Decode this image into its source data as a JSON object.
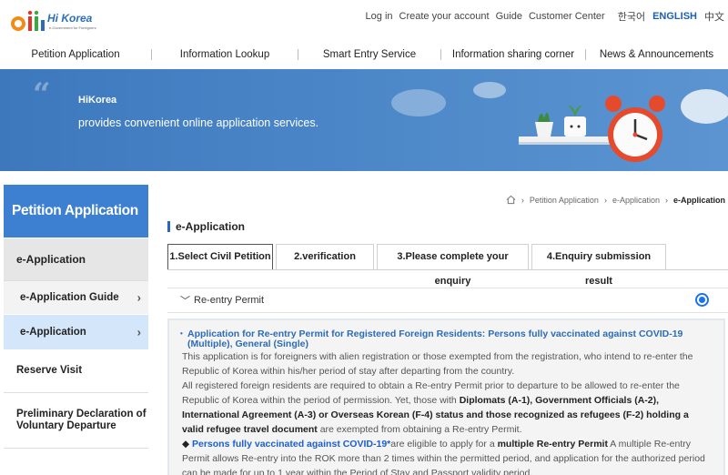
{
  "header": {
    "logo_text": "Hi Korea",
    "logo_sub": "e-Government for Foreigners",
    "util_links": [
      "Log in",
      "Create your account",
      "Guide",
      "Customer Center"
    ],
    "languages": [
      "한국어",
      "ENGLISH",
      "中文"
    ],
    "active_language": "ENGLISH"
  },
  "nav": [
    "Petition Application",
    "Information Lookup",
    "Smart Entry Service",
    "Information sharing corner",
    "News & Announcements"
  ],
  "banner": {
    "title": "HiKorea",
    "subtitle": "provides convenient online application services.",
    "quote_mark": "“"
  },
  "sidebar": {
    "heading": "Petition Application",
    "items": [
      {
        "label": "e-Application"
      },
      {
        "label": "e-Application Guide"
      },
      {
        "label": "e-Application"
      },
      {
        "label": "Reserve Visit"
      },
      {
        "label": "Preliminary Declaration of Voluntary Departure"
      }
    ]
  },
  "breadcrumb": [
    "Petition Application",
    "e-Application",
    "e-Application"
  ],
  "page_title": "e-Application",
  "tabs": [
    "1.Select Civil Petition",
    "2.verification",
    "3.Please complete your enquiry",
    "4.Enquiry submission result"
  ],
  "petition": {
    "label": "Re-entry Permit",
    "selected": true
  },
  "notice": {
    "heading": "Application for Re-entry Permit for Registered Foreign Residents: Persons fully vaccinated against COVID-19 (Multiple), General (Single)",
    "p1": "This application is for foreigners with alien registration or those exempted from the registration, who intend to re-enter the Republic of Korea within his/her period of stay after departing from the country.",
    "p2_a": "All registered foreign residents are required to obtain a Re-entry Permit prior to departure to be allowed to re-enter the Republic of Korea within the period of permission. Yet, those with ",
    "p2_b": "Diplomats (A-1), Government Officials (A-2), International Agreement (A-3) or Overseas Korean (F-4) status and those recognized as refugees (F-2) holding a valid refugee travel document",
    "p2_c": " are exempted from obtaining a Re-entry Permit.",
    "p3_bullet": "◆",
    "p3_a": "Persons fully vaccinated against COVID-19*",
    "p3_b": "are eligible to apply for a ",
    "p3_c": "multiple Re-entry Permit",
    "p3_d": " A multiple Re-entry Permit allows Re-entry into the ROK more than 2 times within the permitted period, and application for the authorized period can be made for up to 1 year within the Period of Stay and Passport validity period."
  }
}
